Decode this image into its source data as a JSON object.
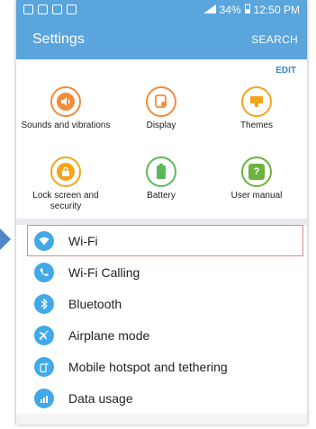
{
  "status_bar": {
    "battery_percent": "34%",
    "time": "12:50 PM"
  },
  "app_bar": {
    "title": "Settings",
    "search_label": "SEARCH"
  },
  "quick_settings": {
    "edit_label": "EDIT",
    "tiles": [
      {
        "label": "Sounds and vibrations",
        "icon": "speaker-icon",
        "color": "#f08c3c"
      },
      {
        "label": "Display",
        "icon": "display-icon",
        "color": "#f08c3c"
      },
      {
        "label": "Themes",
        "icon": "themes-icon",
        "color": "#f3a51d"
      },
      {
        "label": "Lock screen and security",
        "icon": "lock-icon",
        "color": "#f3a51d"
      },
      {
        "label": "Battery",
        "icon": "battery-icon",
        "color": "#5cb85c"
      },
      {
        "label": "User manual",
        "icon": "user-manual-icon",
        "color": "#6cb33f"
      }
    ]
  },
  "settings_list": [
    {
      "label": "Wi-Fi",
      "icon": "wifi-icon",
      "selected": true
    },
    {
      "label": "Wi-Fi Calling",
      "icon": "wifi-calling-icon"
    },
    {
      "label": "Bluetooth",
      "icon": "bluetooth-icon"
    },
    {
      "label": "Airplane mode",
      "icon": "airplane-icon"
    },
    {
      "label": "Mobile hotspot and tethering",
      "icon": "hotspot-icon"
    },
    {
      "label": "Data usage",
      "icon": "data-usage-icon"
    }
  ],
  "colors": {
    "app_bar": "#5aa5dc",
    "list_icon": "#41a9e8",
    "selection_border": "#e08a8a",
    "edit_text": "#3b86c8"
  }
}
